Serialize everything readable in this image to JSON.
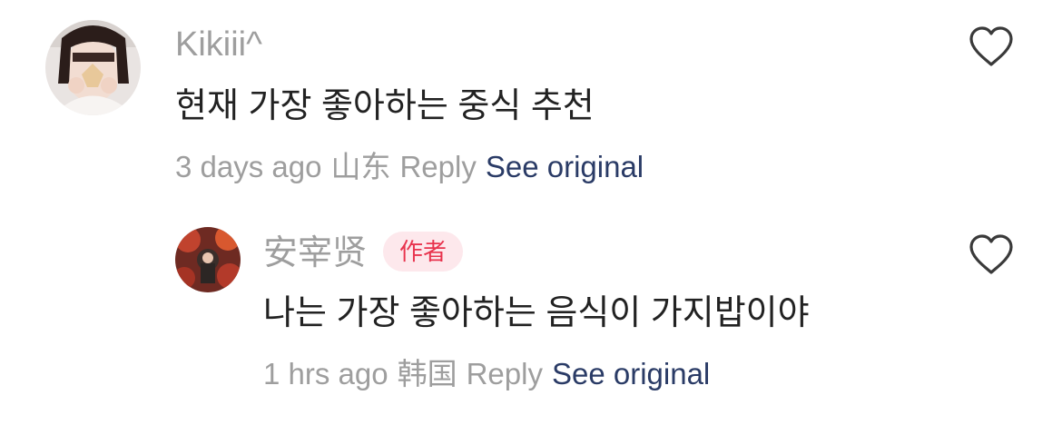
{
  "comments": [
    {
      "username": "Kikiii^",
      "text": "현재 가장 좋아하는 중식 추천",
      "time": "3 days ago",
      "location": "山东",
      "reply_label": "Reply",
      "see_original_label": "See original"
    },
    {
      "username": "安宰贤",
      "badge": "作者",
      "text": "나는 가장 좋아하는 음식이 가지밥이야",
      "time": "1 hrs ago",
      "location": "韩国",
      "reply_label": "Reply",
      "see_original_label": "See original"
    }
  ],
  "colors": {
    "username": "#9e9e9e",
    "body_text": "#222222",
    "meta_text": "#9e9e9e",
    "link": "#2a3b66",
    "badge_bg": "#fde8ec",
    "badge_text": "#e8344e"
  },
  "icons": {
    "like": "heart-outline-icon"
  }
}
